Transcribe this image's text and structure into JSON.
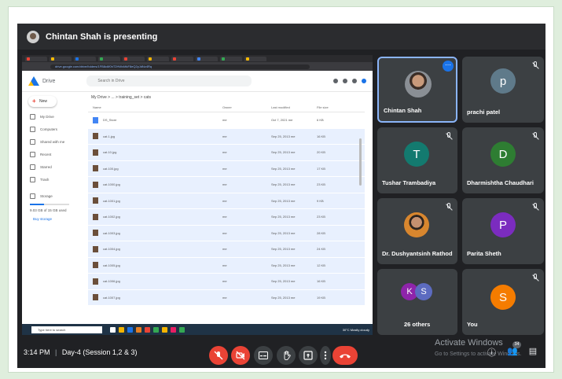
{
  "meet": {
    "presenting_text": "Chintan Shah is presenting",
    "meeting_title": "Day-4 (Session 1,2 & 3)",
    "time": "3:14 PM",
    "separator": "|"
  },
  "shared_screen": {
    "url": "drive.google.com/drive/folders/1FB8c6f0hT2HWxMkF8eQ2yJdNz4Rq",
    "drive_name": "Drive",
    "search_placeholder": "Search in Drive",
    "new_button": "New",
    "nav": [
      "My Drive",
      "Computers",
      "Shared with me",
      "Recent",
      "Starred",
      "Trash",
      "Storage"
    ],
    "storage_text": "9.03 GB of 15 GB used",
    "buy_storage": "Buy storage",
    "breadcrumb": "My Drive  >  ...  >  training_set  >  cats",
    "columns": [
      "Name",
      "Owner",
      "Last modified",
      "File size"
    ],
    "rows": [
      {
        "name": "DS_Store",
        "owner": "me",
        "modified": "Oct 7, 2021 me",
        "size": "6 KB"
      },
      {
        "name": "cat.1.jpg",
        "owner": "me",
        "modified": "Sep 25, 2013 me",
        "size": "16 KB"
      },
      {
        "name": "cat.10.jpg",
        "owner": "me",
        "modified": "Sep 25, 2013 me",
        "size": "20 KB"
      },
      {
        "name": "cat.100.jpg",
        "owner": "me",
        "modified": "Sep 25, 2013 me",
        "size": "17 KB"
      },
      {
        "name": "cat.1000.jpg",
        "owner": "me",
        "modified": "Sep 25, 2013 me",
        "size": "23 KB"
      },
      {
        "name": "cat.1001.jpg",
        "owner": "me",
        "modified": "Sep 25, 2013 me",
        "size": "9 KB"
      },
      {
        "name": "cat.1002.jpg",
        "owner": "me",
        "modified": "Sep 25, 2013 me",
        "size": "23 KB"
      },
      {
        "name": "cat.1003.jpg",
        "owner": "me",
        "modified": "Sep 25, 2013 me",
        "size": "28 KB"
      },
      {
        "name": "cat.1004.jpg",
        "owner": "me",
        "modified": "Sep 25, 2013 me",
        "size": "24 KB"
      },
      {
        "name": "cat.1005.jpg",
        "owner": "me",
        "modified": "Sep 25, 2013 me",
        "size": "12 KB"
      },
      {
        "name": "cat.1006.jpg",
        "owner": "me",
        "modified": "Sep 25, 2013 me",
        "size": "16 KB"
      },
      {
        "name": "cat.1007.jpg",
        "owner": "me",
        "modified": "Sep 25, 2013 me",
        "size": "19 KB"
      }
    ],
    "taskbar_search": "Type here to search",
    "tray_text": "30°C Mostly cloudy"
  },
  "participants": [
    {
      "name": "Chintan Shah",
      "initial": "",
      "color": "#3c4043"
    },
    {
      "name": "prachi patel",
      "initial": "p",
      "color": "#5f7a8a"
    },
    {
      "name": "Tushar Trambadiya",
      "initial": "T",
      "color": "#137a6f"
    },
    {
      "name": "Dharmishtha Chaudhari",
      "initial": "D",
      "color": "#2e7d32"
    },
    {
      "name": "Dr. Dushyantsinh Rathod",
      "initial": "",
      "color": "#3c4043"
    },
    {
      "name": "Parita Sheth",
      "initial": "P",
      "color": "#7b2cbf"
    },
    {
      "name": "26 others",
      "initial": "",
      "color": "#3c4043"
    },
    {
      "name": "You",
      "initial": "S",
      "color": "#f57c00"
    }
  ],
  "others_initials": [
    "K",
    "S"
  ],
  "right_controls": {
    "participant_count": "34",
    "activate_title": "Activate Windows",
    "activate_sub": "Go to Settings to activate Windows."
  }
}
